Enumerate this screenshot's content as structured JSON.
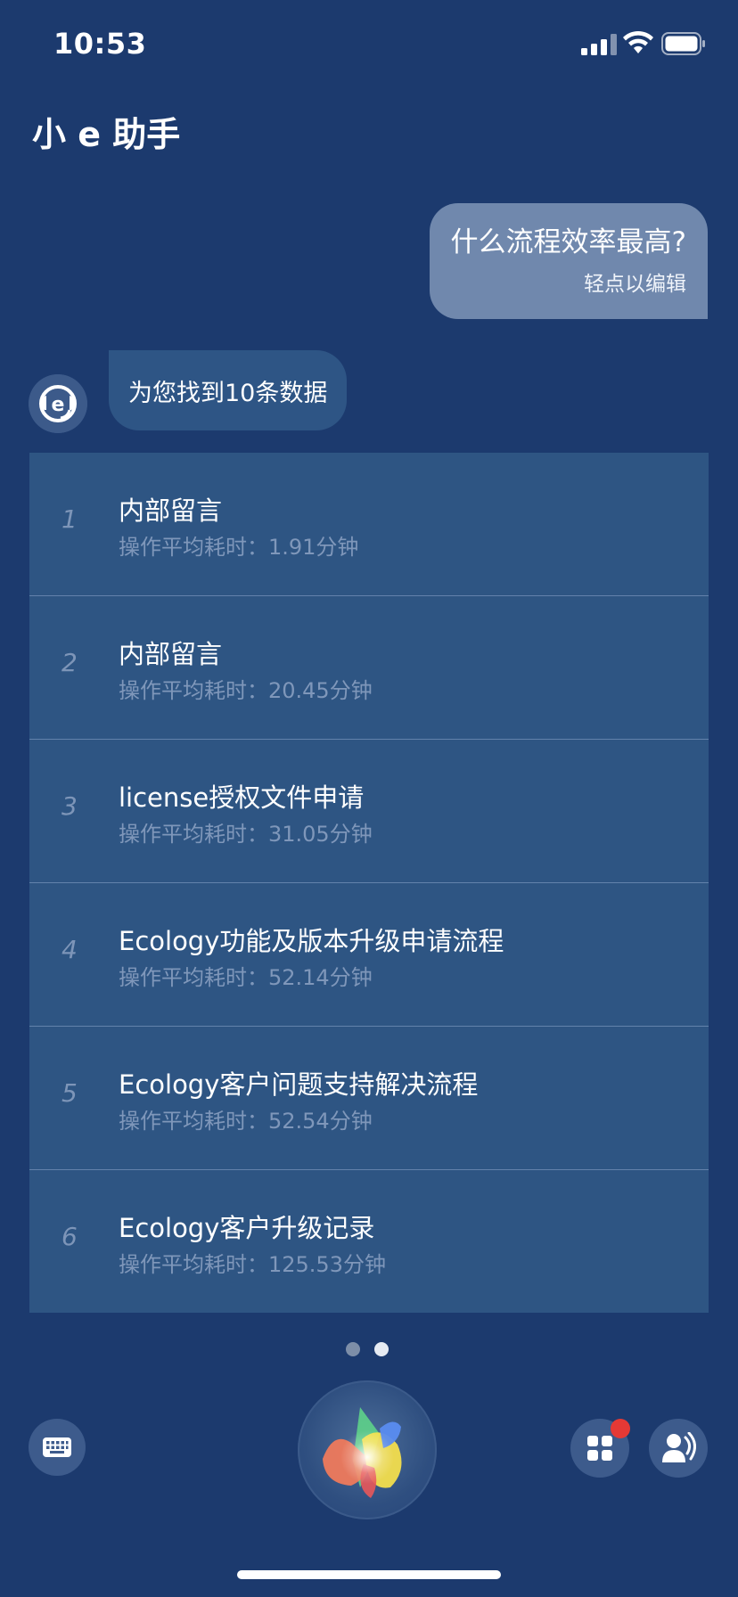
{
  "status_bar": {
    "time": "10:53"
  },
  "header": {
    "title": "小 e 助手"
  },
  "conversation": {
    "user_message": {
      "text": "什么流程效率最高?",
      "hint": "轻点以编辑"
    },
    "bot_message": {
      "text": "为您找到10条数据"
    }
  },
  "results": [
    {
      "index": "1",
      "name": "内部留言",
      "meta": "操作平均耗时：1.91分钟"
    },
    {
      "index": "2",
      "name": "内部留言",
      "meta": "操作平均耗时：20.45分钟"
    },
    {
      "index": "3",
      "name": "license授权文件申请",
      "meta": "操作平均耗时：31.05分钟"
    },
    {
      "index": "4",
      "name": "Ecology功能及版本升级申请流程",
      "meta": "操作平均耗时：52.14分钟"
    },
    {
      "index": "5",
      "name": "Ecology客户问题支持解决流程",
      "meta": "操作平均耗时：52.54分钟"
    },
    {
      "index": "6",
      "name": "Ecology客户升级记录",
      "meta": "操作平均耗时：125.53分钟"
    }
  ],
  "pager": {
    "pages": 2,
    "current": 2
  },
  "bottom_bar": {
    "keyboard_icon": "keyboard-icon",
    "voice_orb_icon": "voice-orb-icon",
    "apps_icon": "apps-grid-icon",
    "contacts_icon": "person-voice-icon",
    "notification_badge": true
  },
  "colors": {
    "background": "#1c3a6e",
    "card": "#2e5583",
    "user_bubble": "#7088ad",
    "badge": "#e53935"
  }
}
